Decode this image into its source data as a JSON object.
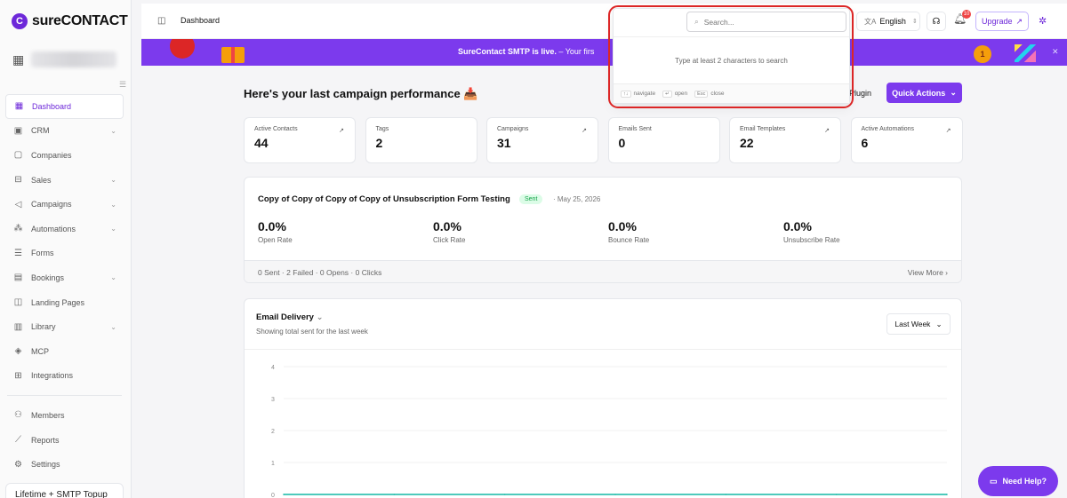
{
  "brand": {
    "name": "sureCONTACT",
    "mark": "C"
  },
  "sidebar": {
    "collapse_icon": "collapse-icon",
    "items": [
      {
        "label": "Dashboard",
        "icon": "dashboard-icon",
        "glyph": "▦",
        "chevron": false,
        "active": true
      },
      {
        "label": "CRM",
        "icon": "crm-icon",
        "glyph": "▣",
        "chevron": true
      },
      {
        "label": "Companies",
        "icon": "building-icon",
        "glyph": "▢",
        "chevron": false
      },
      {
        "label": "Sales",
        "icon": "briefcase-icon",
        "glyph": "⊟",
        "chevron": true
      },
      {
        "label": "Campaigns",
        "icon": "megaphone-icon",
        "glyph": "◁",
        "chevron": true
      },
      {
        "label": "Automations",
        "icon": "automation-icon",
        "glyph": "⁂",
        "chevron": true
      },
      {
        "label": "Forms",
        "icon": "form-icon",
        "glyph": "☰",
        "chevron": false
      },
      {
        "label": "Bookings",
        "icon": "calendar-icon",
        "glyph": "▤",
        "chevron": true
      },
      {
        "label": "Landing Pages",
        "icon": "layout-icon",
        "glyph": "◫",
        "chevron": false
      },
      {
        "label": "Library",
        "icon": "library-icon",
        "glyph": "▥",
        "chevron": true
      },
      {
        "label": "MCP",
        "icon": "mcp-icon",
        "glyph": "◈",
        "chevron": false
      },
      {
        "label": "Integrations",
        "icon": "integrations-icon",
        "glyph": "⊞",
        "chevron": false
      }
    ],
    "bottom_items": [
      {
        "label": "Members",
        "icon": "members-icon",
        "glyph": "⚇"
      },
      {
        "label": "Reports",
        "icon": "reports-icon",
        "glyph": "⟋"
      },
      {
        "label": "Settings",
        "icon": "settings-icon",
        "glyph": "⚙"
      }
    ],
    "plan": "Lifetime + SMTP Topup"
  },
  "topbar": {
    "title": "Dashboard",
    "language": "English",
    "notification_count": "10",
    "upgrade_label": "Upgrade"
  },
  "banner": {
    "text_bold": "SureContact SMTP is live.",
    "text_rest": " – Your firs",
    "medal": "1"
  },
  "search": {
    "placeholder": "Search...",
    "hint": "Type at least 2 characters to search",
    "keys": [
      {
        "key": "↑↓",
        "label": "navigate"
      },
      {
        "key": "↵",
        "label": "open"
      },
      {
        "key": "Esc",
        "label": "close"
      }
    ]
  },
  "main": {
    "heading": "Here's your last campaign performance 📥",
    "plugin_label": "Plugin",
    "quick_actions_label": "Quick Actions",
    "stats": [
      {
        "label": "Active Contacts",
        "value": "44",
        "arrow": true
      },
      {
        "label": "Tags",
        "value": "2",
        "arrow": false
      },
      {
        "label": "Campaigns",
        "value": "31",
        "arrow": true
      },
      {
        "label": "Emails Sent",
        "value": "0",
        "arrow": false
      },
      {
        "label": "Email Templates",
        "value": "22",
        "arrow": true
      },
      {
        "label": "Active Automations",
        "value": "6",
        "arrow": true
      }
    ],
    "campaign": {
      "title": "Copy of Copy of Copy of Copy of Unsubscription Form Testing",
      "status": "Sent",
      "date": "· May 25, 2026",
      "metrics": [
        {
          "value": "0.0%",
          "label": "Open Rate"
        },
        {
          "value": "0.0%",
          "label": "Click Rate"
        },
        {
          "value": "0.0%",
          "label": "Bounce Rate"
        },
        {
          "value": "0.0%",
          "label": "Unsubscribe Rate"
        }
      ],
      "footer": "0 Sent · 2 Failed · 0 Opens · 0 Clicks",
      "view_more": "View More"
    },
    "delivery": {
      "title": "Email Delivery",
      "subtitle": "Showing total sent for the last week",
      "range": "Last Week"
    }
  },
  "chart_data": {
    "type": "line",
    "title": "Email Delivery",
    "y_ticks": [
      "4",
      "3",
      "2",
      "1",
      "0"
    ],
    "ylim": [
      0,
      4
    ],
    "grid": true,
    "series": [
      {
        "values": [
          0,
          0,
          0,
          0,
          0,
          0,
          0
        ]
      }
    ],
    "line_color": "#14b8a6"
  },
  "need_help": "Need Help?"
}
